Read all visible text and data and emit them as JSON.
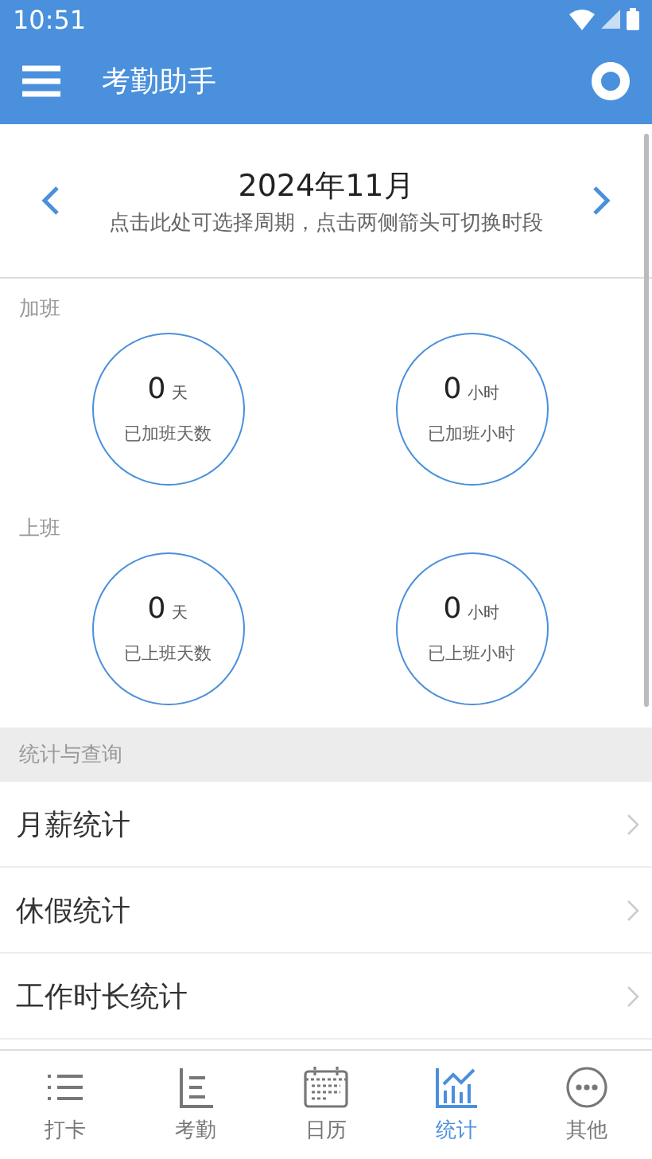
{
  "status_bar": {
    "time": "10:51"
  },
  "app_bar": {
    "title": "考勤助手"
  },
  "period": {
    "title": "2024年11月",
    "hint": "点击此处可选择周期，点击两侧箭头可切换时段"
  },
  "groups": [
    {
      "label": "加班",
      "cards": [
        {
          "value": "0",
          "unit": "天",
          "caption": "已加班天数"
        },
        {
          "value": "0",
          "unit": "小时",
          "caption": "已加班小时"
        }
      ]
    },
    {
      "label": "上班",
      "cards": [
        {
          "value": "0",
          "unit": "天",
          "caption": "已上班天数"
        },
        {
          "value": "0",
          "unit": "小时",
          "caption": "已上班小时"
        }
      ]
    }
  ],
  "section_header": "统计与查询",
  "menu_items": [
    "月薪统计",
    "休假统计",
    "工作时长统计"
  ],
  "tabs": [
    {
      "kind": "list",
      "label": "打卡",
      "selected": false
    },
    {
      "kind": "axis",
      "label": "考勤",
      "selected": false
    },
    {
      "kind": "calendar",
      "label": "日历",
      "selected": false
    },
    {
      "kind": "chart",
      "label": "统计",
      "selected": true
    },
    {
      "kind": "more",
      "label": "其他",
      "selected": false
    }
  ]
}
